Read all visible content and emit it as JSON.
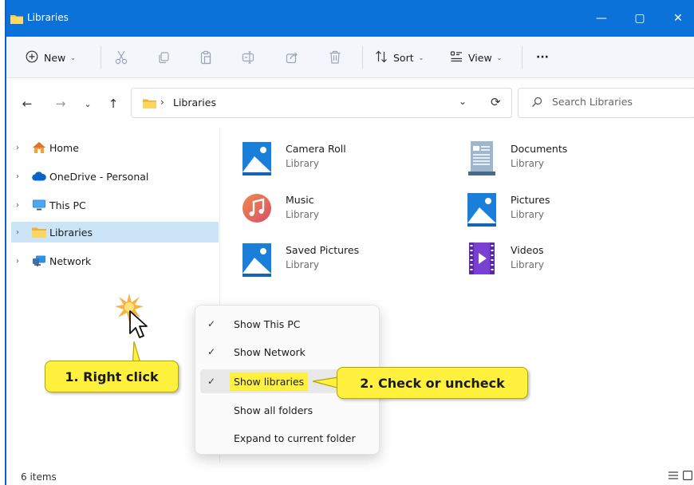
{
  "window": {
    "title": "Libraries",
    "controls": {
      "minimize": "—",
      "maximize": "▢",
      "close": "✕"
    }
  },
  "toolbar": {
    "new_label": "New",
    "sort_label": "Sort",
    "view_label": "View",
    "more_label": "···",
    "icons": [
      "cut-icon",
      "copy-icon",
      "paste-icon",
      "rename-icon",
      "share-icon",
      "delete-icon"
    ]
  },
  "address": {
    "breadcrumb_separator": "›",
    "current": "Libraries",
    "search_placeholder": "Search Libraries"
  },
  "sidebar": {
    "items": [
      {
        "label": "Home",
        "icon": "home-icon"
      },
      {
        "label": "OneDrive - Personal",
        "icon": "cloud-icon"
      },
      {
        "label": "This PC",
        "icon": "monitor-icon"
      },
      {
        "label": "Libraries",
        "icon": "folder-icon",
        "selected": true
      },
      {
        "label": "Network",
        "icon": "network-icon"
      }
    ]
  },
  "libraries": [
    {
      "name": "Camera Roll",
      "type": "Library",
      "icon": "pictures-library-icon"
    },
    {
      "name": "Documents",
      "type": "Library",
      "icon": "documents-library-icon"
    },
    {
      "name": "Music",
      "type": "Library",
      "icon": "music-library-icon"
    },
    {
      "name": "Pictures",
      "type": "Library",
      "icon": "pictures-library-icon"
    },
    {
      "name": "Saved Pictures",
      "type": "Library",
      "icon": "pictures-library-icon"
    },
    {
      "name": "Videos",
      "type": "Library",
      "icon": "videos-library-icon"
    }
  ],
  "context_menu": {
    "check_glyph": "✓",
    "items": [
      {
        "label": "Show This PC",
        "checked": true
      },
      {
        "label": "Show Network",
        "checked": true
      },
      {
        "label": "Show libraries",
        "checked": true,
        "highlighted": true
      },
      {
        "label": "Show all folders",
        "checked": false
      },
      {
        "label": "Expand to current folder",
        "checked": false
      }
    ]
  },
  "callouts": {
    "step1": "1. Right click",
    "step2": "2. Check or uncheck"
  },
  "status": {
    "item_count": "6 items"
  },
  "colors": {
    "titlebar": "#0b72d9",
    "selected_nav": "#cce4f7",
    "callout_yellow": "#fff13d"
  }
}
